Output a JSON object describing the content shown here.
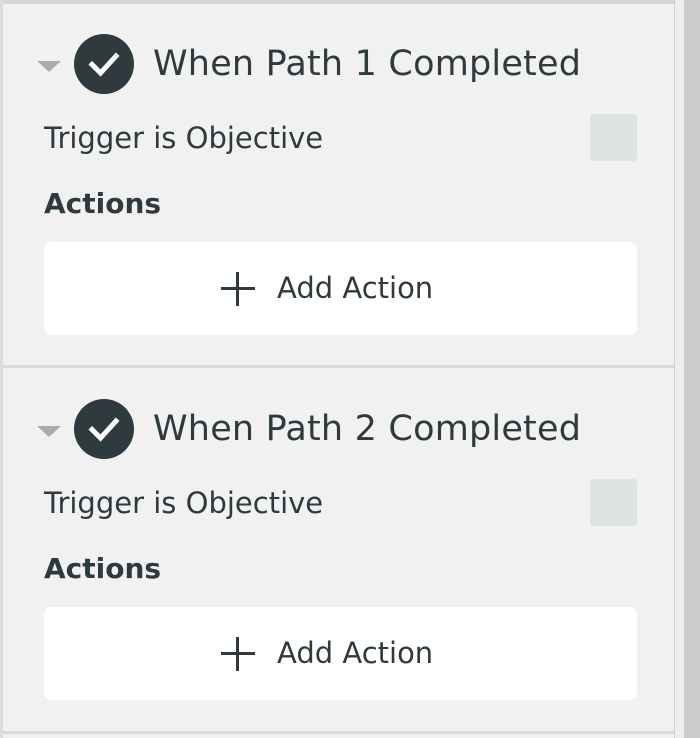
{
  "triggers": [
    {
      "title": "When Path 1 Completed",
      "objective_label": "Trigger is Objective",
      "objective_checked": false,
      "actions_heading": "Actions",
      "add_action_label": "Add Action",
      "completed": true,
      "expanded": true
    },
    {
      "title": "When Path 2 Completed",
      "objective_label": "Trigger is Objective",
      "objective_checked": false,
      "actions_heading": "Actions",
      "add_action_label": "Add Action",
      "completed": true,
      "expanded": true
    }
  ],
  "icons": {
    "collapse": "chevron-down-icon",
    "completed": "check-circle-icon",
    "add": "plus-icon"
  },
  "colors": {
    "panel_bg": "#f1f1f1",
    "text": "#2f3a3e",
    "check_circle": "#2f3a3e",
    "checkbox": "#dfe3e4",
    "button_bg": "#ffffff",
    "chevron": "#a7adae"
  }
}
